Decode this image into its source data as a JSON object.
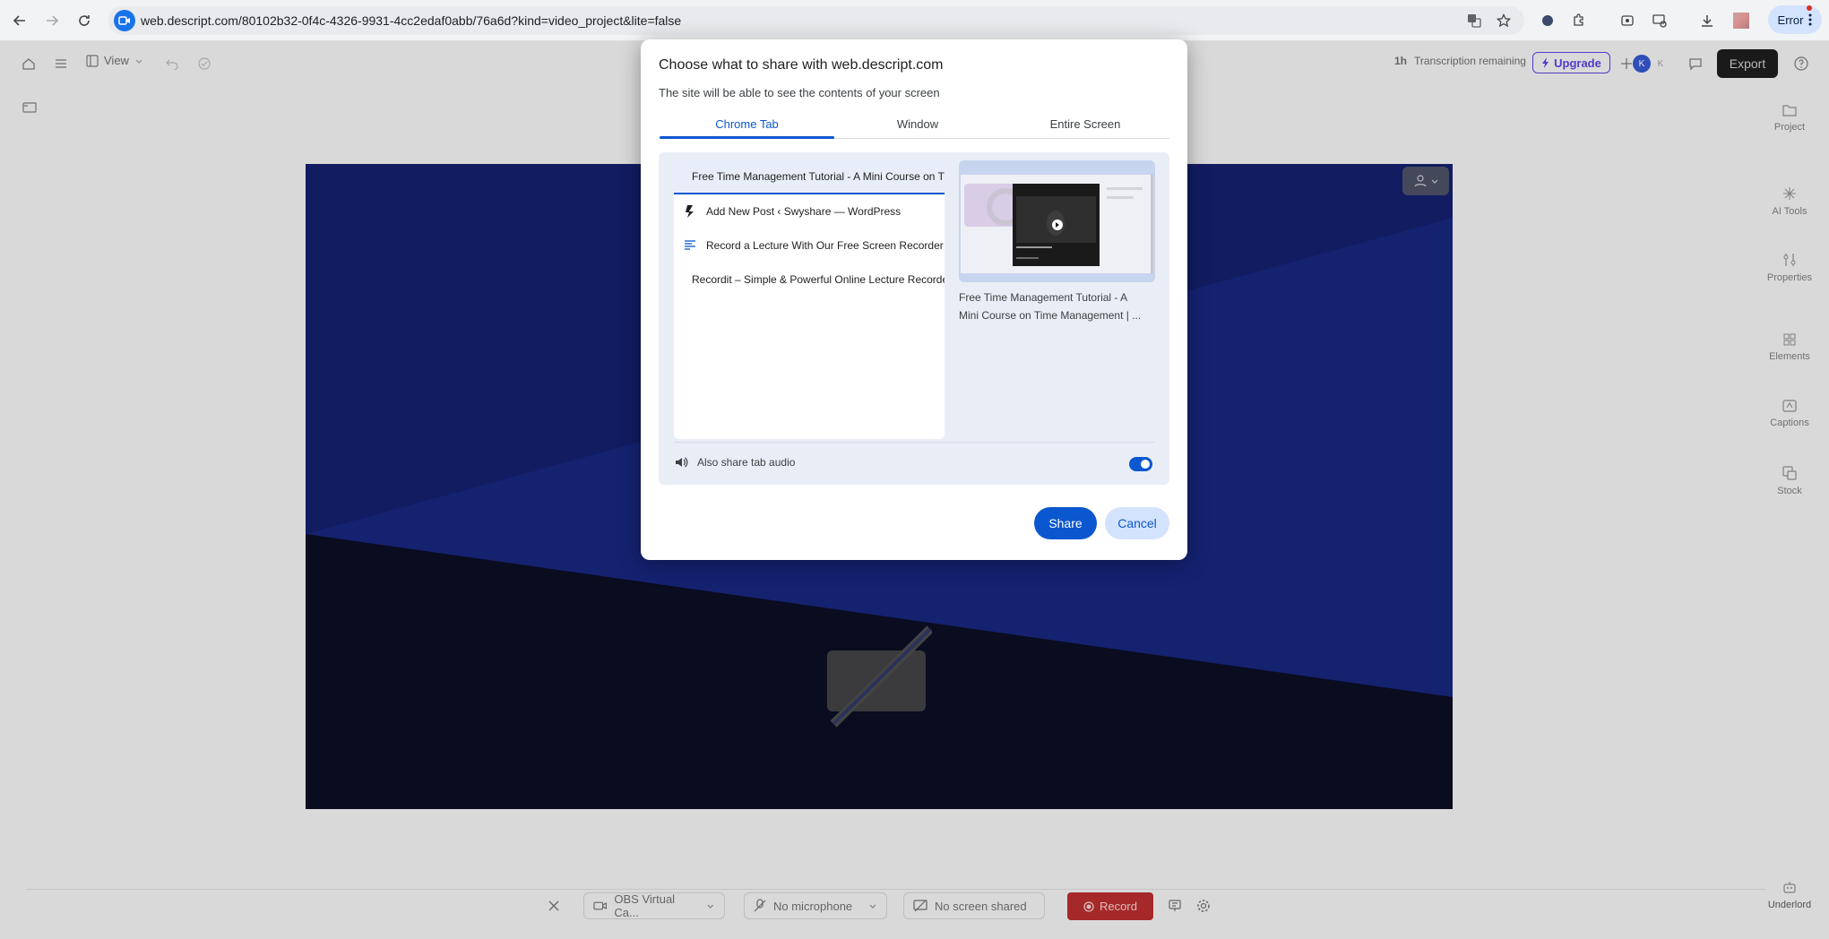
{
  "browser": {
    "url": "web.descript.com/80102b32-0f4c-4326-9931-4cc2edaf0abb/76a6d?kind=video_project&lite=false",
    "profile_status": "Error"
  },
  "toolbar": {
    "view_label": "View",
    "transcription_hours": "1h",
    "transcription_label": "Transcription remaining",
    "upgrade_label": "Upgrade",
    "avatar_letter": "K",
    "export_label": "Export"
  },
  "sidebar": {
    "items": [
      {
        "label": "Project",
        "icon": "folder-icon"
      },
      {
        "label": "AI Tools",
        "icon": "sparkle-icon"
      },
      {
        "label": "Properties",
        "icon": "sliders-icon"
      },
      {
        "label": "Elements",
        "icon": "grid-icon"
      },
      {
        "label": "Captions",
        "icon": "captions-icon"
      },
      {
        "label": "Stock",
        "icon": "stock-icon"
      }
    ],
    "bottom_label": "Underlord"
  },
  "record_bar": {
    "camera": "OBS Virtual Ca...",
    "microphone": "No microphone",
    "screen": "No screen shared",
    "record_label": "Record"
  },
  "dialog": {
    "title": "Choose what to share with web.descript.com",
    "subtitle": "The site will be able to see the contents of your screen",
    "tabs": [
      "Chrome Tab",
      "Window",
      "Entire Screen"
    ],
    "selected_tab": "Chrome Tab",
    "tab_items": [
      {
        "title": "Free Time Management Tutorial - A Mini Course on Time Management",
        "icon": "purple-app-icon"
      },
      {
        "title": "Add New Post ‹ Swyshare — WordPress",
        "icon": "descript-icon"
      },
      {
        "title": "Record a Lecture With Our Free Screen Recorder",
        "icon": "doc-icon"
      },
      {
        "title": "Recordit – Simple & Powerful Online Lecture Recorder",
        "icon": "descript-icon"
      }
    ],
    "preview_caption_line1": "Free Time Management Tutorial - A",
    "preview_caption_line2": "Mini Course on Time Management | ...",
    "audio_label": "Also share tab audio",
    "audio_enabled": true,
    "share_label": "Share",
    "cancel_label": "Cancel"
  },
  "colors": {
    "accent": "#0b57d0",
    "record": "#b42d2d",
    "upgrade": "#5b3fd9"
  }
}
